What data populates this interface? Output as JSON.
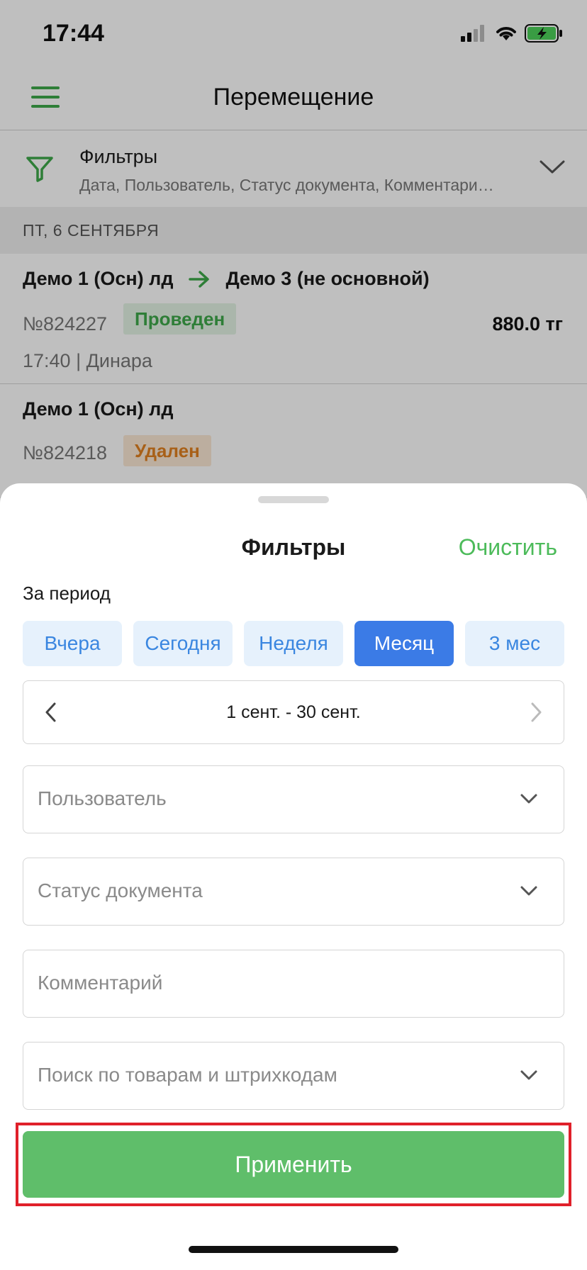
{
  "status_bar": {
    "time": "17:44"
  },
  "header": {
    "title": "Перемещение"
  },
  "filters_summary": {
    "title": "Фильтры",
    "subtitle": "Дата, Пользователь, Статус документа, Комментари…"
  },
  "date_group": "ПТ, 6 СЕНТЯБРЯ",
  "documents": [
    {
      "from": "Демо 1 (Осн) лд",
      "to": "Демо 3 (не основной)",
      "number": "№824227",
      "status": "Проведен",
      "sum": "880.0 тг",
      "meta": "17:40 | Динара"
    },
    {
      "from": "Демо 1 (Осн) лд",
      "number": "№824218",
      "status": "Удален"
    }
  ],
  "sheet": {
    "title": "Фильтры",
    "clear_label": "Очистить",
    "period_label": "За период",
    "period_options": [
      "Вчера",
      "Сегодня",
      "Неделя",
      "Месяц",
      "3 мес"
    ],
    "selected_period": "Месяц",
    "date_range": "1 сент. - 30 сент.",
    "fields": {
      "user": "Пользователь",
      "doc_status": "Статус документа",
      "comment": "Комментарий",
      "product_search": "Поиск по товарам и штрихкодам"
    },
    "apply_label": "Применить"
  },
  "colors": {
    "accent_green": "#4cbb5a",
    "accent_blue": "#3b7be6",
    "highlight_red": "#e0202a"
  }
}
